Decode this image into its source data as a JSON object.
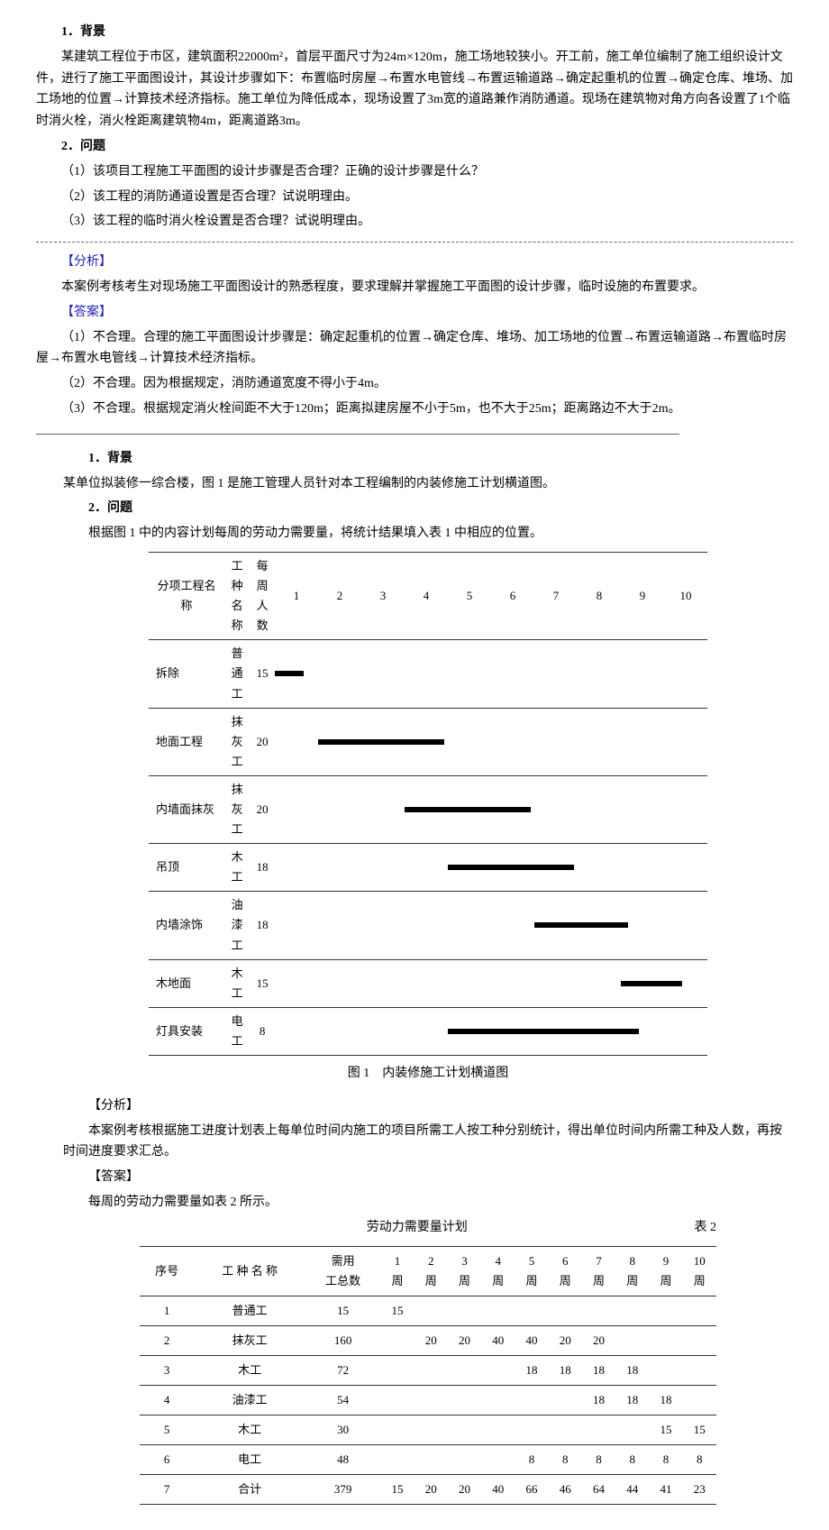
{
  "case1": {
    "h1": "1．背景",
    "bg": "某建筑工程位于市区，建筑面积22000m²，首层平面尺寸为24m×120m，施工场地较狭小。开工前，施工单位编制了施工组织设计文件，进行了施工平面图设计，其设计步骤如下：布置临时房屋→布置水电管线→布置运输道路→确定起重机的位置→确定仓库、堆场、加工场地的位置→计算技术经济指标。施工单位为降低成本，现场设置了3m宽的道路兼作消防通道。现场在建筑物对角方向各设置了1个临时消火栓，消火栓距离建筑物4m，距离道路3m。",
    "h2": "2．问题",
    "q1": "（1）该项目工程施工平面图的设计步骤是否合理？正确的设计步骤是什么？",
    "q2": "（2）该工程的消防通道设置是否合理？试说明理由。",
    "q3": "（3）该工程的临时消火栓设置是否合理？试说明理由。",
    "an_h": "【分析】",
    "an_body": "本案例考核考生对现场施工平面图设计的熟悉程度，要求理解并掌握施工平面图的设计步骤，临时设施的布置要求。",
    "ans_h": "【答案】",
    "a1": "（1）不合理。合理的施工平面图设计步骤是：确定起重机的位置→确定仓库、堆场、加工场地的位置→布置运输道路→布置临时房屋→布置水电管线→计算技术经济指标。",
    "a2": "（2）不合理。因为根据规定，消防通道宽度不得小于4m。",
    "a3": "（3）不合理。根据规定消火栓间距不大于120m；距离拟建房屋不小于5m，也不大于25m；距离路边不大于2m。"
  },
  "case2": {
    "h1": "1．背景",
    "bg": "某单位拟装修一综合楼，图 1 是施工管理人员针对本工程编制的内装修施工计划横道图。",
    "h2": "2．问题",
    "q": "根据图 1 中的内容计划每周的劳动力需要量，将统计结果填入表 1 中相应的位置。",
    "gantt": {
      "headers": [
        "分项工程名　　称",
        "工 种 名 称",
        "每周人数",
        "1",
        "2",
        "3",
        "4",
        "5",
        "6",
        "7",
        "8",
        "9",
        "10"
      ],
      "rows": [
        {
          "name": "拆除",
          "trade": "普通工",
          "num": "15",
          "start": 1,
          "end": 1
        },
        {
          "name": "地面工程",
          "trade": "抹灰工",
          "num": "20",
          "start": 2,
          "end": 5
        },
        {
          "name": "内墙面抹灰",
          "trade": "抹灰工",
          "num": "20",
          "start": 4,
          "end": 7
        },
        {
          "name": "吊顶",
          "trade": "木工",
          "num": "18",
          "start": 5,
          "end": 8
        },
        {
          "name": "内墙涂饰",
          "trade": "油漆工",
          "num": "18",
          "start": 7,
          "end": 9
        },
        {
          "name": "木地面",
          "trade": "木工",
          "num": "15",
          "start": 9,
          "end": 10
        },
        {
          "name": "灯具安装",
          "trade": "电工",
          "num": "8",
          "start": 5,
          "end": 10
        }
      ]
    },
    "caption1": "图 1　内装修施工计划横道图",
    "an_h": "【分析】",
    "an_body": "本案例考核根据施工进度计划表上每单位时间内施工的项目所需工人按工种分别统计，得出单位时间内所需工种及人数，再按时间进度要求汇总。",
    "ans_h": "【答案】",
    "ans_intro": "每周的劳动力需要量如表 2 所示。",
    "table2_title": "劳动力需要量计划",
    "table2_label": "表 2",
    "demand": {
      "headers": [
        "序号",
        "工 种 名 称",
        "需用工总数",
        "1周",
        "2周",
        "3周",
        "4周",
        "5周",
        "6周",
        "7周",
        "8周",
        "9周",
        "10周"
      ],
      "rows": [
        [
          "1",
          "普通工",
          "15",
          "15",
          "",
          "",
          "",
          "",
          "",
          "",
          "",
          "",
          ""
        ],
        [
          "2",
          "抹灰工",
          "160",
          "",
          "20",
          "20",
          "40",
          "40",
          "20",
          "20",
          "",
          "",
          ""
        ],
        [
          "3",
          "木工",
          "72",
          "",
          "",
          "",
          "",
          "18",
          "18",
          "18",
          "18",
          "",
          ""
        ],
        [
          "4",
          "油漆工",
          "54",
          "",
          "",
          "",
          "",
          "",
          "",
          "18",
          "18",
          "18",
          ""
        ],
        [
          "5",
          "木工",
          "30",
          "",
          "",
          "",
          "",
          "",
          "",
          "",
          "",
          "15",
          "15"
        ],
        [
          "6",
          "电工",
          "48",
          "",
          "",
          "",
          "",
          "8",
          "8",
          "8",
          "8",
          "8",
          "8"
        ],
        [
          "7",
          "合计",
          "379",
          "15",
          "20",
          "20",
          "40",
          "66",
          "46",
          "64",
          "44",
          "41",
          "23"
        ]
      ]
    }
  },
  "chart_data": {
    "type": "gantt",
    "title": "图 1 内装修施工计划横道图",
    "x_unit": "周",
    "x_range": [
      1,
      10
    ],
    "tasks": [
      {
        "name": "拆除",
        "trade": "普通工",
        "weekly_workers": 15,
        "start": 1,
        "end": 1
      },
      {
        "name": "地面工程",
        "trade": "抹灰工",
        "weekly_workers": 20,
        "start": 2,
        "end": 5
      },
      {
        "name": "内墙面抹灰",
        "trade": "抹灰工",
        "weekly_workers": 20,
        "start": 4,
        "end": 7
      },
      {
        "name": "吊顶",
        "trade": "木工",
        "weekly_workers": 18,
        "start": 5,
        "end": 8
      },
      {
        "name": "内墙涂饰",
        "trade": "油漆工",
        "weekly_workers": 18,
        "start": 7,
        "end": 9
      },
      {
        "name": "木地面",
        "trade": "木工",
        "weekly_workers": 15,
        "start": 9,
        "end": 10
      },
      {
        "name": "灯具安装",
        "trade": "电工",
        "weekly_workers": 8,
        "start": 5,
        "end": 10
      }
    ]
  }
}
